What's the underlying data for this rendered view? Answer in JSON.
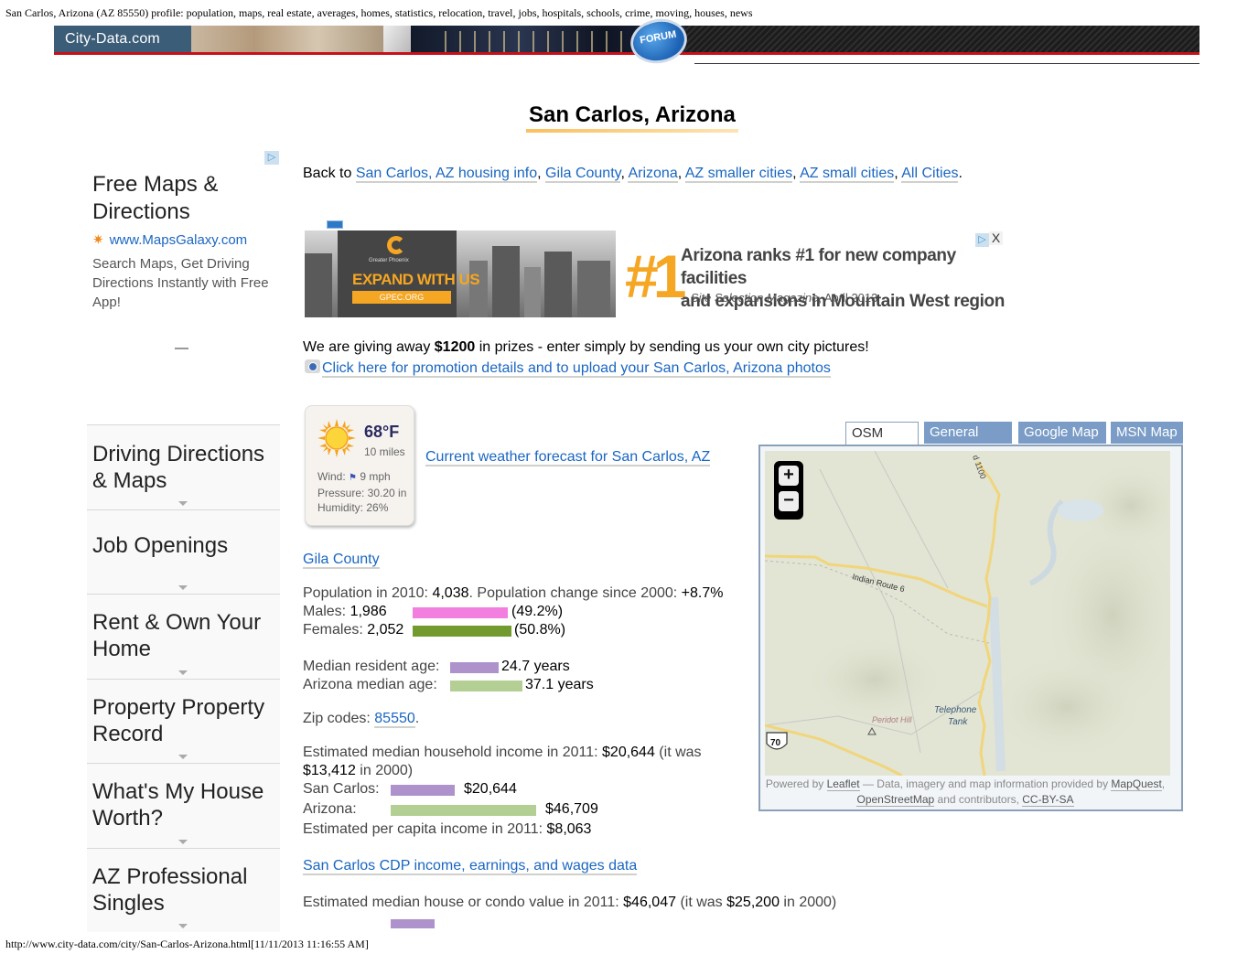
{
  "print_header": "San Carlos, Arizona (AZ 85550) profile: population, maps, real estate, averages, homes, statistics, relocation, travel, jobs, hospitals, schools, crime, moving, houses, news",
  "print_footer": "http://www.city-data.com/city/San-Carlos-Arizona.html[11/11/2013 11:16:55 AM]",
  "banner": {
    "logo": "City-Data.com",
    "forum_badge": "FORUM"
  },
  "page_title": "San Carlos, Arizona",
  "left_ad": {
    "title": "Free Maps & Directions",
    "url": "www.MapsGalaxy.com",
    "description": "Search Maps, Get Driving Directions Instantly with Free App!",
    "dash": "—"
  },
  "sidebar": {
    "items": [
      {
        "label": "Driving Directions & Maps"
      },
      {
        "label": "Job Openings"
      },
      {
        "label": "Rent & Own Your Home"
      },
      {
        "label": "Property Property Record"
      },
      {
        "label": "What's My House Worth?"
      },
      {
        "label": "AZ Professional Singles"
      }
    ]
  },
  "back_to": {
    "prefix": "Back to ",
    "links": [
      "San Carlos, AZ housing info",
      "Gila County",
      "Arizona",
      "AZ smaller cities",
      "AZ small cities",
      "All Cities"
    ]
  },
  "banner_ad": {
    "small_brand": "Greater Phoenix",
    "headline": "EXPAND WITH US",
    "button": "GPEC.ORG",
    "big_number": "#1",
    "text_line1": "Arizona ranks #1 for new company facilities",
    "text_line2": "and expansions in Mountain West region",
    "source_prefix": "– ",
    "source_italic": "Site Selection Magazine",
    "source_suffix": ", April 2013",
    "close_label": "X"
  },
  "promo": {
    "text_before": "We are giving away ",
    "amount": "$1200",
    "text_after": " in prizes - enter simply by sending us your own city pictures!",
    "link": "Click here for promotion details and to upload your San Carlos, Arizona photos"
  },
  "weather": {
    "temperature": "68°F",
    "visibility": "10 miles",
    "wind_label": "Wind:",
    "wind_value": "9 mph",
    "pressure": "Pressure: 30.20 in",
    "humidity": "Humidity: 26%",
    "link": "Current weather forecast for San Carlos, AZ"
  },
  "county_link": "Gila County",
  "population": {
    "label": "Population in 2010: ",
    "value": "4,038",
    "change_label": ". Population change since 2000: ",
    "change_value": "+8.7%",
    "males_label": "Males: ",
    "males_value": "1,986",
    "males_pct": "(49.2%)",
    "males_fraction": 0.492,
    "females_label": "Females: ",
    "females_value": "2,052",
    "females_pct": "(50.8%)",
    "females_fraction": 0.508,
    "male_color": "#f27ee0",
    "female_color": "#739a2f"
  },
  "age": {
    "median_label": "Median resident age: ",
    "median_value": "24.7 years",
    "median_years": 24.7,
    "state_label": "Arizona median age: ",
    "state_value": "37.1 years",
    "state_years": 37.1,
    "local_color": "#ae92cc",
    "state_color": "#b3cf93"
  },
  "zip": {
    "label": "Zip codes: ",
    "code": "85550",
    "suffix": "."
  },
  "income": {
    "line1_label": "Estimated median household income in 2011: ",
    "line1_value": "$20,644",
    "line1_tail_label": " (it was",
    "line2_value": "$13,412",
    "line2_label": " in 2000)",
    "local_label": "San Carlos:",
    "local_value": "$20,644",
    "local_amount": 20644,
    "state_label": "Arizona:",
    "state_value": "$46,709",
    "state_amount": 46709,
    "per_capita_label": "Estimated per capita income in 2011: ",
    "per_capita_value": "$8,063"
  },
  "cdp_link": "San Carlos CDP income, earnings, and wages data",
  "house_value": {
    "label": "Estimated median house or condo value in 2011: ",
    "value": "$46,047",
    "was_label": " (it was ",
    "was_value": "$25,200",
    "was_suffix": " in 2000)"
  },
  "map": {
    "tabs": [
      {
        "label": "OSM Map",
        "active": true
      },
      {
        "label": "General Map",
        "active": false
      },
      {
        "label": "Google Map",
        "active": false
      },
      {
        "label": "MSN Map",
        "active": false
      }
    ],
    "zoom_in": "+",
    "zoom_out": "−",
    "labels": {
      "road_top": "d 1100",
      "road_indian": "Indian Route 6",
      "hill": "Peridot Hill",
      "tank": "Telephone Tank",
      "shield": "70"
    },
    "attribution": {
      "powered_by": "Powered by ",
      "leaflet": "Leaflet",
      "middle": " — Data, imagery and map information provided by ",
      "mapquest": "MapQuest",
      "comma": ",",
      "osm": "OpenStreetMap",
      "and": " and contributors, ",
      "license": "CC-BY-SA"
    }
  }
}
